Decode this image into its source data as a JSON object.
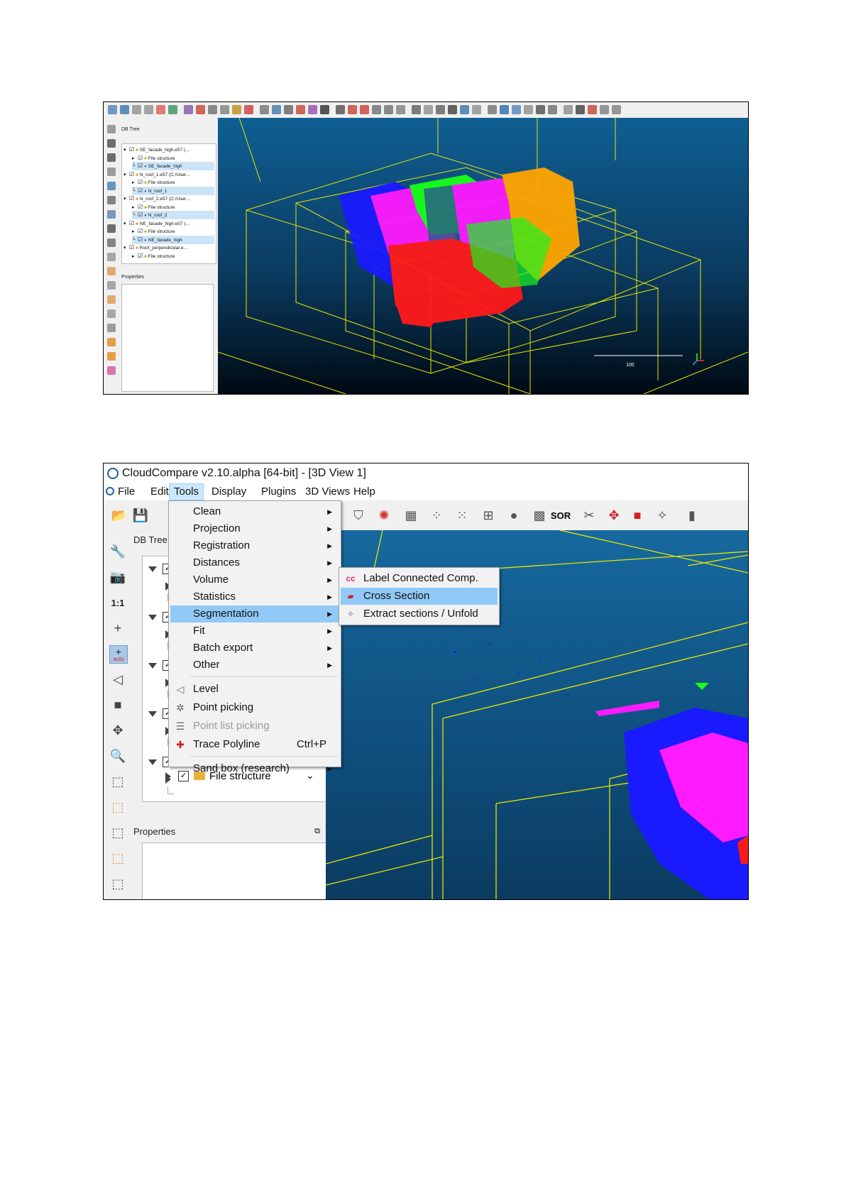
{
  "screenshot1": {
    "db_tree_title": "DB Tree",
    "properties_title": "Properties",
    "tree_rows": [
      {
        "label": "SE_facade_high.e57 (...",
        "kind": "root",
        "selected": false
      },
      {
        "label": "File structure",
        "kind": "folder",
        "selected": false
      },
      {
        "label": "SE_facade_high",
        "kind": "cloud",
        "selected": true
      },
      {
        "label": "N_roof_1.e57 (C:/User...",
        "kind": "root",
        "selected": false
      },
      {
        "label": "File structure",
        "kind": "folder",
        "selected": false
      },
      {
        "label": "N_roof_1",
        "kind": "cloud",
        "selected": true
      },
      {
        "label": "N_roof_2.e57 (C:/User...",
        "kind": "root",
        "selected": false
      },
      {
        "label": "File structure",
        "kind": "folder",
        "selected": false
      },
      {
        "label": "N_roof_2",
        "kind": "cloud",
        "selected": true
      },
      {
        "label": "NE_facade_high.e57 (...",
        "kind": "root",
        "selected": false
      },
      {
        "label": "File structure",
        "kind": "folder",
        "selected": false
      },
      {
        "label": "NE_facade_high",
        "kind": "cloud",
        "selected": true
      },
      {
        "label": "Roof_perpendicular.e...",
        "kind": "root",
        "selected": false
      },
      {
        "label": "File structure",
        "kind": "folder",
        "selected": false
      }
    ],
    "scale_label": "100",
    "colors": {
      "background_top": "#0f5f93",
      "background_bottom": "#000a14",
      "bbox": "#e6e600",
      "cloud_blue": "#1a1aff",
      "cloud_magenta": "#ff1aff",
      "cloud_green": "#1aff1a",
      "cloud_orange": "#ffa500",
      "cloud_red": "#ff1a1a"
    }
  },
  "screenshot2": {
    "window_title": "CloudCompare v2.10.alpha [64-bit] - [3D View 1]",
    "menubar": [
      "File",
      "Edit",
      "Tools",
      "Display",
      "Plugins",
      "3D Views",
      "Help"
    ],
    "active_menu": "Tools",
    "db_tree_title": "DB Tree",
    "properties_title": "Properties",
    "tree_file_structure_label": "File structure",
    "toolbar_sor_label": "SOR",
    "left_tool_11_label": "1:1",
    "left_tool_auto_label": "auto",
    "tools_menu": [
      {
        "label": "Clean",
        "submenu": true
      },
      {
        "label": "Projection",
        "submenu": true
      },
      {
        "label": "Registration",
        "submenu": true
      },
      {
        "label": "Distances",
        "submenu": true
      },
      {
        "label": "Volume",
        "submenu": true
      },
      {
        "label": "Statistics",
        "submenu": true
      },
      {
        "label": "Segmentation",
        "submenu": true,
        "highlighted": true
      },
      {
        "label": "Fit",
        "submenu": true
      },
      {
        "label": "Batch export",
        "submenu": true
      },
      {
        "label": "Other",
        "submenu": true
      },
      {
        "label": "Level",
        "icon": "level-icon"
      },
      {
        "label": "Point picking",
        "icon": "point-picking-icon"
      },
      {
        "label": "Point list picking",
        "icon": "point-list-picking-icon",
        "disabled": true
      },
      {
        "label": "Trace Polyline",
        "icon": "trace-polyline-icon",
        "shortcut": "Ctrl+P"
      },
      {
        "label": "Sand box (research)",
        "submenu": true
      }
    ],
    "segmentation_submenu": [
      {
        "label": "Label Connected Comp.",
        "icon": "label-connected-comp-icon"
      },
      {
        "label": "Cross Section",
        "icon": "cross-section-icon",
        "highlighted": true
      },
      {
        "label": "Extract sections / Unfold",
        "icon": "extract-sections-icon"
      }
    ],
    "colors": {
      "menu_highlight": "#91c9f7",
      "active_menubar": "#cce8ff",
      "view_background": "#16699f",
      "bbox": "#e6e600"
    }
  }
}
